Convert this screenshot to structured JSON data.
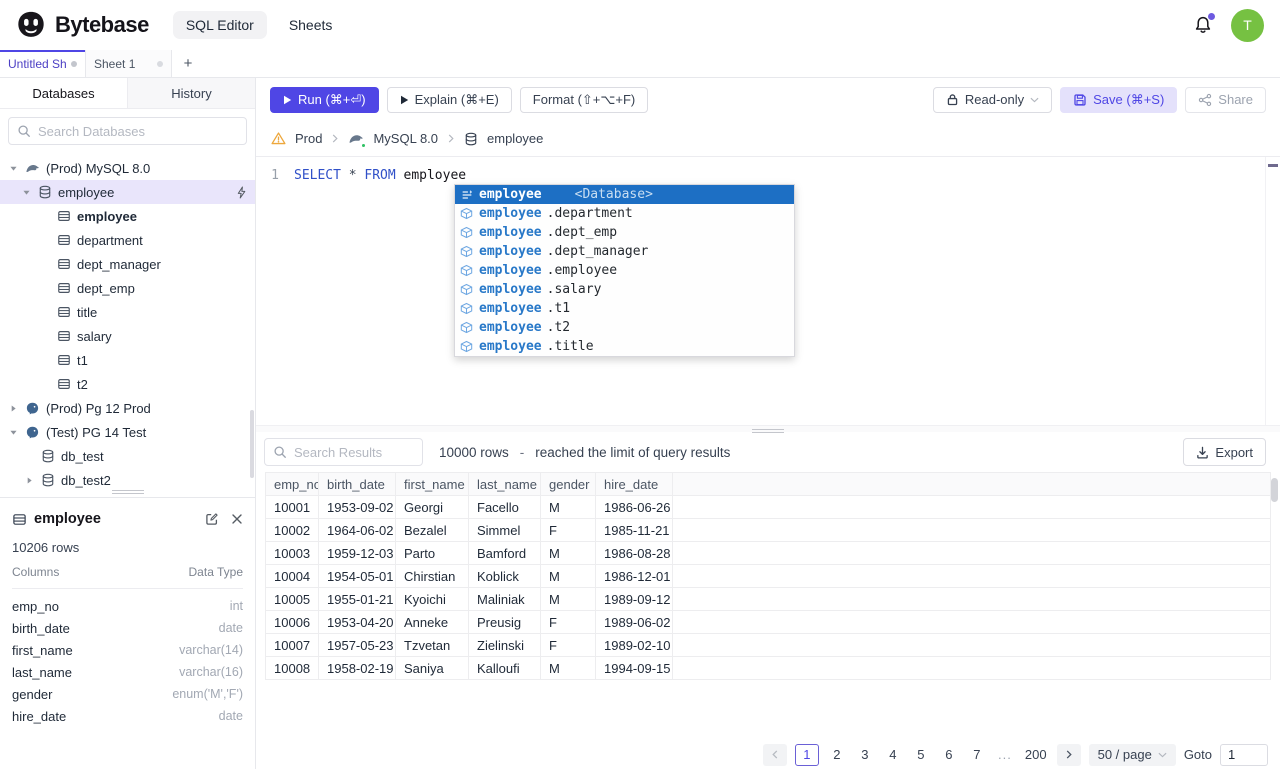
{
  "accent_color": "#4f46e5",
  "header": {
    "brand": "Bytebase",
    "nav_sql_editor": "SQL Editor",
    "nav_sheets": "Sheets",
    "avatar_initial": "T"
  },
  "sheet_tabs": {
    "tab1": "Untitled Sheet",
    "tab2": "Sheet 1",
    "new_tab": "+"
  },
  "sidebar": {
    "tab_databases": "Databases",
    "tab_history": "History",
    "search_placeholder": "Search Databases",
    "tree": [
      {
        "label": "(Prod) MySQL 8.0"
      },
      {
        "label": "employee"
      },
      {
        "label": "employee"
      },
      {
        "label": "department"
      },
      {
        "label": "dept_manager"
      },
      {
        "label": "dept_emp"
      },
      {
        "label": "title"
      },
      {
        "label": "salary"
      },
      {
        "label": "t1"
      },
      {
        "label": "t2"
      },
      {
        "label": "(Prod) Pg 12 Prod"
      },
      {
        "label": "(Test) PG 14 Test"
      },
      {
        "label": "db_test"
      },
      {
        "label": "db_test2"
      }
    ]
  },
  "schema_panel": {
    "title": "employee",
    "row_count": "10206 rows",
    "columns_header": "Columns",
    "type_header": "Data Type",
    "columns": [
      {
        "name": "emp_no",
        "type": "int"
      },
      {
        "name": "birth_date",
        "type": "date"
      },
      {
        "name": "first_name",
        "type": "varchar(14)"
      },
      {
        "name": "last_name",
        "type": "varchar(16)"
      },
      {
        "name": "gender",
        "type": "enum('M','F')"
      },
      {
        "name": "hire_date",
        "type": "date"
      }
    ]
  },
  "toolbar": {
    "run": "Run (⌘+⏎)",
    "explain": "Explain (⌘+E)",
    "format": "Format (⇧+⌥+F)",
    "readonly": "Read-only",
    "save": "Save (⌘+S)",
    "share": "Share"
  },
  "breadcrumb": {
    "environment": "Prod",
    "instance": "MySQL 8.0",
    "database": "employee"
  },
  "editor": {
    "line_number": "1",
    "keyword_select": "SELECT",
    "star": "*",
    "keyword_from": "FROM",
    "identifier": "employee"
  },
  "autocomplete": {
    "selected": {
      "name": "employee",
      "detail": "<Database>"
    },
    "items": [
      {
        "prefix": "employee",
        "suffix": ".department"
      },
      {
        "prefix": "employee",
        "suffix": ".dept_emp"
      },
      {
        "prefix": "employee",
        "suffix": ".dept_manager"
      },
      {
        "prefix": "employee",
        "suffix": ".employee"
      },
      {
        "prefix": "employee",
        "suffix": ".salary"
      },
      {
        "prefix": "employee",
        "suffix": ".t1"
      },
      {
        "prefix": "employee",
        "suffix": ".t2"
      },
      {
        "prefix": "employee",
        "suffix": ".title"
      }
    ]
  },
  "results": {
    "search_placeholder": "Search Results",
    "row_count": "10000 rows",
    "dash": "-",
    "limit_note": "reached the limit of query results",
    "export_label": "Export",
    "headers": [
      "emp_no",
      "birth_date",
      "first_name",
      "last_name",
      "gender",
      "hire_date"
    ],
    "rows": [
      [
        "10001",
        "1953-09-02",
        "Georgi",
        "Facello",
        "M",
        "1986-06-26"
      ],
      [
        "10002",
        "1964-06-02",
        "Bezalel",
        "Simmel",
        "F",
        "1985-11-21"
      ],
      [
        "10003",
        "1959-12-03",
        "Parto",
        "Bamford",
        "M",
        "1986-08-28"
      ],
      [
        "10004",
        "1954-05-01",
        "Chirstian",
        "Koblick",
        "M",
        "1986-12-01"
      ],
      [
        "10005",
        "1955-01-21",
        "Kyoichi",
        "Maliniak",
        "M",
        "1989-09-12"
      ],
      [
        "10006",
        "1953-04-20",
        "Anneke",
        "Preusig",
        "F",
        "1989-06-02"
      ],
      [
        "10007",
        "1957-05-23",
        "Tzvetan",
        "Zielinski",
        "F",
        "1989-02-10"
      ],
      [
        "10008",
        "1958-02-19",
        "Saniya",
        "Kalloufi",
        "M",
        "1994-09-15"
      ]
    ]
  },
  "pagination": {
    "pages": [
      "1",
      "2",
      "3",
      "4",
      "5",
      "6",
      "7"
    ],
    "ellipsis": "...",
    "last_page": "200",
    "page_size": "50 / page",
    "goto_label": "Goto",
    "goto_value": "1"
  }
}
